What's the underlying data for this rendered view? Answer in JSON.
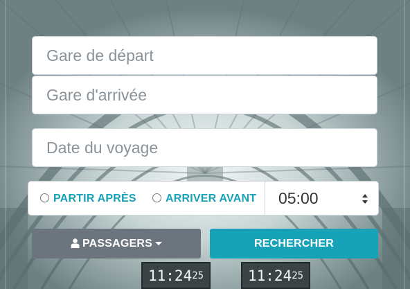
{
  "form": {
    "departure_placeholder": "Gare de départ",
    "arrival_placeholder": "Gare d'arrivée",
    "date_placeholder": "Date du voyage",
    "option_after": "PARTIR APRÈS",
    "option_before": "ARRIVER AVANT",
    "time_value": "05:00",
    "passengers_label": "PASSAGERS",
    "search_label": "RECHERCHER"
  },
  "background": {
    "clock_1_main": "11:24",
    "clock_1_sec": "25",
    "clock_2_main": "11:24",
    "clock_2_sec": "25"
  },
  "icons": {
    "passengers": "user-icon",
    "passengers_caret": "caret-down-icon",
    "time_select": "sort-arrows-icon"
  },
  "colors": {
    "accent": "#17a2b8",
    "secondary": "#6c757d"
  }
}
